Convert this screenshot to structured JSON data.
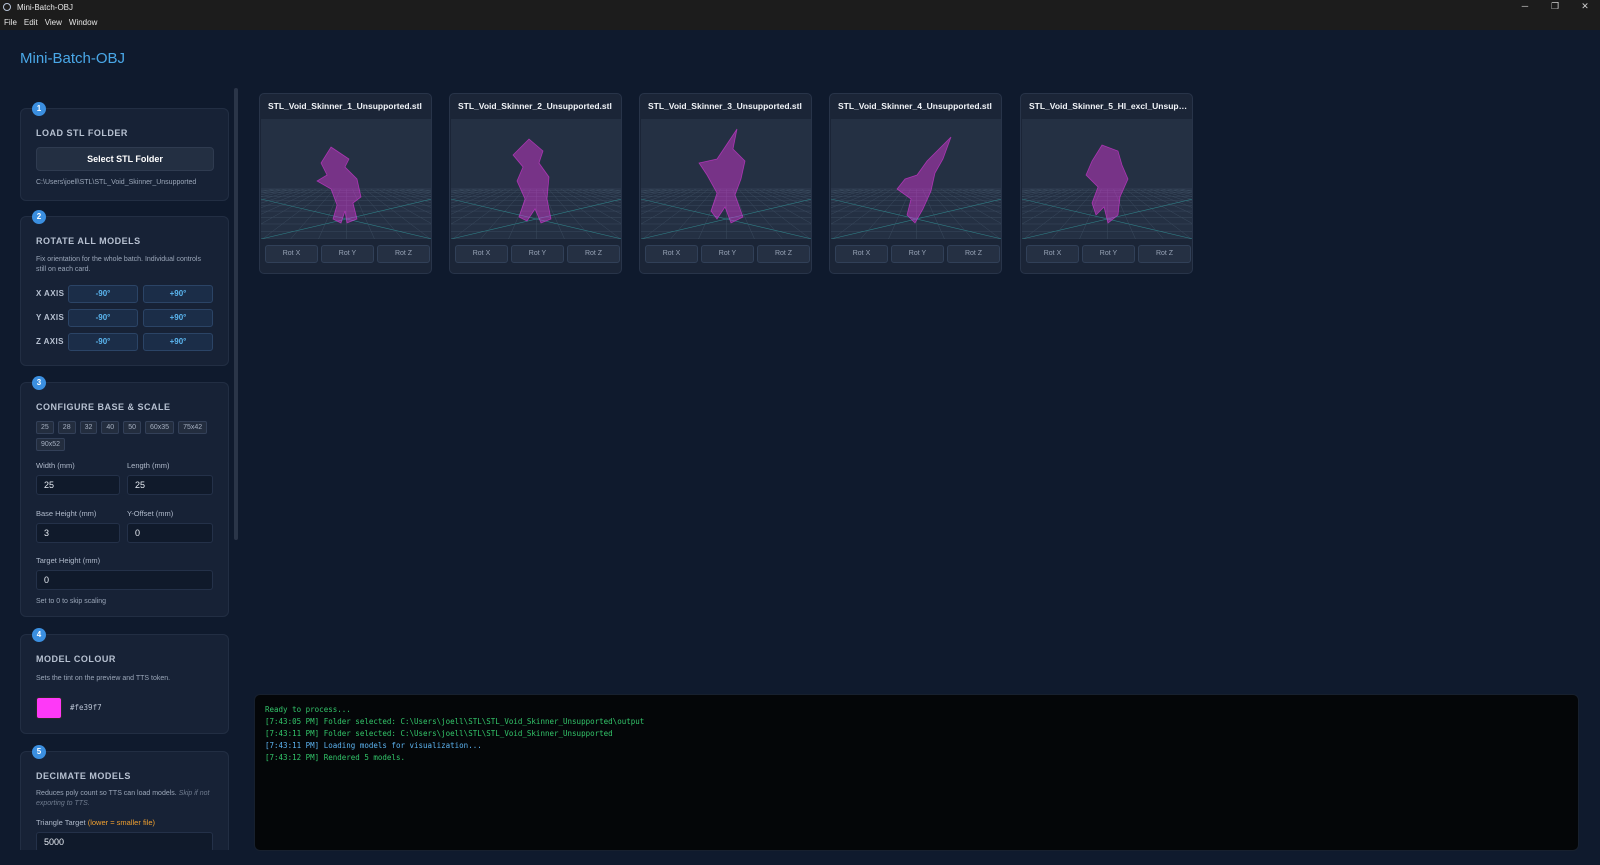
{
  "window": {
    "title": "Mini-Batch-OBJ",
    "icon": "gear-icon",
    "controls": [
      "─",
      "❐",
      "✕"
    ]
  },
  "menu": [
    "File",
    "Edit",
    "View",
    "Window"
  ],
  "app_title": "Mini-Batch-OBJ",
  "steps": {
    "load": {
      "number": "1",
      "heading": "LOAD STL FOLDER",
      "button": "Select STL Folder",
      "path": "C:\\Users\\joell\\STL\\STL_Void_Skinner_Unsupported"
    },
    "rotate": {
      "number": "2",
      "heading": "ROTATE ALL MODELS",
      "description": "Fix orientation for the whole batch. Individual controls still on each card.",
      "axes": [
        {
          "label": "X AXIS",
          "minus": "-90°",
          "plus": "+90°"
        },
        {
          "label": "Y AXIS",
          "minus": "-90°",
          "plus": "+90°"
        },
        {
          "label": "Z AXIS",
          "minus": "-90°",
          "plus": "+90°"
        }
      ]
    },
    "base": {
      "number": "3",
      "heading": "CONFIGURE BASE & SCALE",
      "presets_row1": [
        "25",
        "28",
        "32",
        "40",
        "50",
        "60x35",
        "75x42"
      ],
      "presets_row2": [
        "90x52"
      ],
      "width_label": "Width (mm)",
      "width_value": "25",
      "length_label": "Length (mm)",
      "length_value": "25",
      "base_height_label": "Base Height (mm)",
      "base_height_value": "3",
      "y_offset_label": "Y-Offset (mm)",
      "y_offset_value": "0",
      "target_height_label": "Target Height (mm)",
      "target_height_value": "0",
      "hint": "Set to 0 to skip scaling"
    },
    "colour": {
      "number": "4",
      "heading": "MODEL COLOUR",
      "description": "Sets the tint on the preview and TTS token.",
      "hex": "#fe39f7",
      "swatch_color": "#fe39f7"
    },
    "decimate": {
      "number": "5",
      "heading": "DECIMATE MODELS",
      "description": "Reduces poly count so TTS can load models.",
      "description_note": "Skip if not exporting to TTS.",
      "target_label": "Triangle Target",
      "target_hint": "(lower = smaller file)",
      "target_value": "5000"
    }
  },
  "models": [
    {
      "name": "STL_Void_Skinner_1_Unsupported.stl",
      "rot": [
        "Rot X",
        "Rot Y",
        "Rot Z"
      ]
    },
    {
      "name": "STL_Void_Skinner_2_Unsupported.stl",
      "rot": [
        "Rot X",
        "Rot Y",
        "Rot Z"
      ]
    },
    {
      "name": "STL_Void_Skinner_3_Unsupported.stl",
      "rot": [
        "Rot X",
        "Rot Y",
        "Rot Z"
      ]
    },
    {
      "name": "STL_Void_Skinner_4_Unsupported.stl",
      "rot": [
        "Rot X",
        "Rot Y",
        "Rot Z"
      ]
    },
    {
      "name": "STL_Void_Skinner_5_HI_excl_Unsuppor...",
      "rot": [
        "Rot X",
        "Rot Y",
        "Rot Z"
      ]
    }
  ],
  "log": [
    {
      "text": "Ready to process...",
      "color": "#33c56a"
    },
    {
      "text": "[7:43:05 PM] Folder selected: C:\\Users\\joell\\STL\\STL_Void_Skinner_Unsupported\\output",
      "color": "#33c56a"
    },
    {
      "text": "[7:43:11 PM] Folder selected: C:\\Users\\joell\\STL\\STL_Void_Skinner_Unsupported",
      "color": "#33c56a"
    },
    {
      "text": "[7:43:11 PM] Loading models for visualization...",
      "color": "#5cb3f0"
    },
    {
      "text": "[7:43:12 PM] Rendered 5 models.",
      "color": "#33c56a"
    }
  ],
  "colors": {
    "accent": "#4aa8e8",
    "badge": "#3b8fe0",
    "model_tint": "#fe39f7",
    "hint_orange": "#f0a030"
  }
}
